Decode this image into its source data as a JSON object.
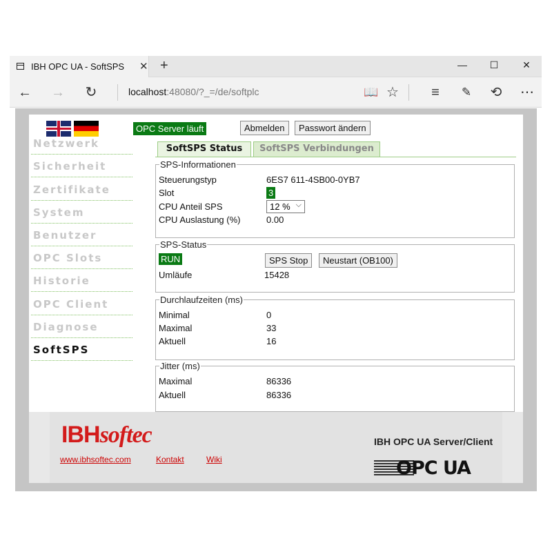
{
  "browser": {
    "tab_title": "IBH OPC UA - SoftSPS",
    "url_host": "localhost",
    "url_rest": ":48080/?_=/de/softplc"
  },
  "header": {
    "server_status": "OPC Server läuft",
    "logout_label": "Abmelden",
    "change_password_label": "Passwort ändern"
  },
  "sidebar": {
    "items": [
      {
        "label": "Netzwerk"
      },
      {
        "label": "Sicherheit"
      },
      {
        "label": "Zertifikate"
      },
      {
        "label": "System"
      },
      {
        "label": "Benutzer"
      },
      {
        "label": "OPC Slots"
      },
      {
        "label": "Historie"
      },
      {
        "label": "OPC Client"
      },
      {
        "label": "Diagnose"
      },
      {
        "label": "SoftSPS"
      }
    ],
    "active": "SoftSPS"
  },
  "tabs": [
    {
      "label": "SoftSPS Status"
    },
    {
      "label": "SoftSPS Verbindungen"
    }
  ],
  "sps_info": {
    "legend": "SPS-Informationen",
    "controller_type_label": "Steuerungstyp",
    "controller_type_value": "6ES7 611-4SB00-0YB7",
    "slot_label": "Slot",
    "slot_value": "3",
    "cpu_share_label": "CPU Anteil SPS",
    "cpu_share_value": "12 %",
    "cpu_load_label": "CPU Auslastung (%)",
    "cpu_load_value": "0.00"
  },
  "sps_status": {
    "legend": "SPS-Status",
    "state": "RUN",
    "stop_label": "SPS Stop",
    "restart_label": "Neustart (OB100)",
    "cycles_label": "Umläufe",
    "cycles_value": "15428"
  },
  "cycle_times": {
    "legend": "Durchlaufzeiten (ms)",
    "min_label": "Minimal",
    "min_value": "0",
    "max_label": "Maximal",
    "max_value": "33",
    "current_label": "Aktuell",
    "current_value": "16"
  },
  "jitter": {
    "legend": "Jitter (ms)",
    "max_label": "Maximal",
    "max_value": "86336",
    "current_label": "Aktuell",
    "current_value": "86336"
  },
  "footer": {
    "logo_ibh": "IBH",
    "logo_soft": "softec",
    "link_website": "www.ibhsoftec.com",
    "link_contact": "Kontakt",
    "link_wiki": "Wiki",
    "product_name": "IBH OPC UA Server/Client",
    "opc_logo_text": "OPC UA"
  },
  "colors": {
    "status_green": "#0a7a14",
    "tab_border_green": "#9ccc84",
    "brand_red": "#d31b1b"
  }
}
